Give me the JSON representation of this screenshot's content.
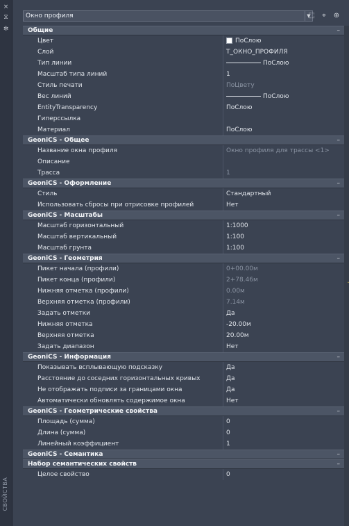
{
  "strip": {
    "close_glyph": "×",
    "pin_glyph": "⧖",
    "settings_glyph": "✲",
    "label": "СВОЙСТВА"
  },
  "selector": {
    "value": "Окно профиля"
  },
  "toolbar": {
    "quick_select_glyph": "⬚",
    "select_objects_glyph": "⌖",
    "toggle_pickadd_glyph": "⊕"
  },
  "categories": [
    {
      "title": "Общие",
      "rows": [
        {
          "key": "Цвет",
          "value": "ПоСлою",
          "style": "swatch"
        },
        {
          "key": "Слой",
          "value": "Т_ОКНО_ПРОФИЛЯ"
        },
        {
          "key": "Тип линии",
          "value": "ПоСлою",
          "style": "line"
        },
        {
          "key": "Масштаб типа линий",
          "value": "1"
        },
        {
          "key": "Стиль печати",
          "value": "ПоЦвету",
          "dim": true
        },
        {
          "key": "Вес линий",
          "value": "ПоСлою",
          "style": "line"
        },
        {
          "key": "EntityTransparency",
          "value": "ПоСлою"
        },
        {
          "key": "Гиперссылка",
          "value": ""
        },
        {
          "key": "Материал",
          "value": "ПоСлою"
        }
      ]
    },
    {
      "title": "GeoniCS - Общее",
      "rows": [
        {
          "key": "Название окна профиля",
          "value": "Окно профиля для трассы <1>",
          "dim": true
        },
        {
          "key": "Описание",
          "value": ""
        },
        {
          "key": "Трасса",
          "value": "1",
          "dim": true
        }
      ]
    },
    {
      "title": "GeoniCS - Оформление",
      "rows": [
        {
          "key": "Стиль",
          "value": "Стандартный"
        },
        {
          "key": "Использовать сбросы при отрисовке профилей",
          "value": "Нет"
        }
      ]
    },
    {
      "title": "GeoniCS - Масштабы",
      "rows": [
        {
          "key": "Масштаб горизонтальный",
          "value": "1:1000"
        },
        {
          "key": "Масштаб вертикальный",
          "value": "1:100"
        },
        {
          "key": "Масштаб грунта",
          "value": "1:100"
        }
      ]
    },
    {
      "title": "GeoniCS - Геометрия",
      "rows": [
        {
          "key": "Пикет начала (профили)",
          "value": "0+00.00м",
          "dim": true
        },
        {
          "key": "Пикет конца (профили)",
          "value": "2+78.46м",
          "dim": true
        },
        {
          "key": "Нижняя отметка (профили)",
          "value": "0.00м",
          "dim": true
        },
        {
          "key": "Верхняя отметка (профили)",
          "value": "7.14м",
          "dim": true
        },
        {
          "key": "Задать отметки",
          "value": "Да"
        },
        {
          "key": "Нижняя отметка",
          "value": "-20.00м"
        },
        {
          "key": "Верхняя отметка",
          "value": "20.00м"
        },
        {
          "key": "Задать диапазон",
          "value": "Нет"
        }
      ]
    },
    {
      "title": "GeoniCS - Информация",
      "rows": [
        {
          "key": "Показывать всплывающую подсказку",
          "value": "Да"
        },
        {
          "key": "Расстояние до соседних горизонтальных кривых",
          "value": "Да"
        },
        {
          "key": "Не отображать подписи за границами окна",
          "value": "Да"
        },
        {
          "key": "Автоматически обновлять содержимое окна",
          "value": "Нет"
        }
      ]
    },
    {
      "title": "GeoniCS - Геометрические свойства",
      "rows": [
        {
          "key": "Площадь (сумма)",
          "value": "0"
        },
        {
          "key": "Длина (сумма)",
          "value": "0"
        },
        {
          "key": "Линейный коэффициент",
          "value": "1"
        }
      ]
    },
    {
      "title": "GeoniCS - Семантика",
      "rows": []
    },
    {
      "title": "Набор семантических свойств",
      "rows": [
        {
          "key": "Целое свойство",
          "value": "0"
        }
      ]
    }
  ],
  "collapse_glyph": "–"
}
